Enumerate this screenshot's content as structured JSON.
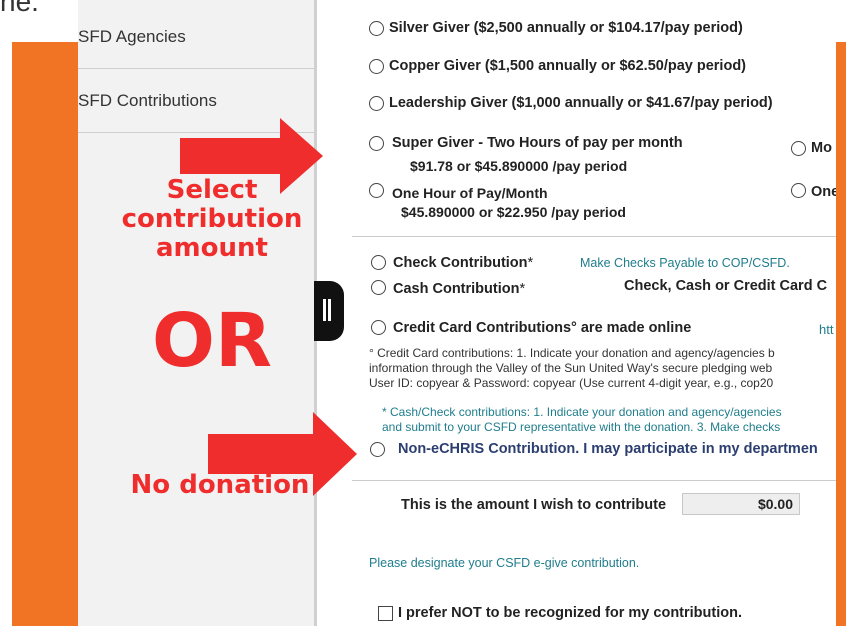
{
  "top_fragment": "ne.",
  "sidebar": {
    "items": [
      {
        "label": "SFD Agencies"
      },
      {
        "label": "SFD Contributions"
      }
    ]
  },
  "options": {
    "silver": "Silver Giver ($2,500 annually or $104.17/pay period)",
    "copper": "Copper Giver ($1,500 annually or $62.50/pay period)",
    "leadership": "Leadership Giver ($1,000 annually or $41.67/pay period)",
    "super_giver": "Super Giver - Two Hours of pay per month",
    "super_giver_amounts": "$91.78  or $45.890000 /pay period",
    "super_giver_right_cut": "Mo",
    "one_hour": "One Hour of Pay/Month",
    "one_hour_amounts": "$45.890000    or      $22.950  /pay period",
    "one_hour_right_cut": "One"
  },
  "payment": {
    "check": "Check Contribution",
    "check_star": "*",
    "check_note": "Make Checks Payable to COP/CSFD.",
    "cash": "Cash Contribution",
    "cash_star": "*",
    "cash_note": "Check, Cash or Credit Card C",
    "credit": "Credit Card Contributions",
    "credit_suffix": "° are made online",
    "credit_link_cut": "htt",
    "cc_note_1": "° Credit Card contributions: 1. Indicate your donation and agency/agencies b",
    "cc_note_2": "information through the Valley of the Sun United Way's secure pledging web",
    "cc_note_3": "User ID: copyear & Password: copyear (Use current 4-digit year, e.g., cop20",
    "cash_note_1": "* Cash/Check contributions: 1. Indicate your donation and agency/agencies",
    "cash_note_2": "and submit to your CSFD representative with the donation. 3. Make checks",
    "non_echris": "Non-eCHRIS Contribution. I may participate in my departmen"
  },
  "amount": {
    "label": "This is the amount I wish to contribute",
    "value": "$0.00"
  },
  "designate": "Please designate your CSFD e-give contribution.",
  "recognize_label": "I prefer NOT to be recognized for my contribution.",
  "annotations": {
    "select_amount": [
      "Select",
      "contribution",
      "amount"
    ],
    "or": "OR",
    "no_donation": "No donation"
  },
  "colors": {
    "orange": "#f07423",
    "annotation_red": "#ef2d2d",
    "teal_text": "#1f7d8c",
    "navy_text": "#2c3e70"
  }
}
